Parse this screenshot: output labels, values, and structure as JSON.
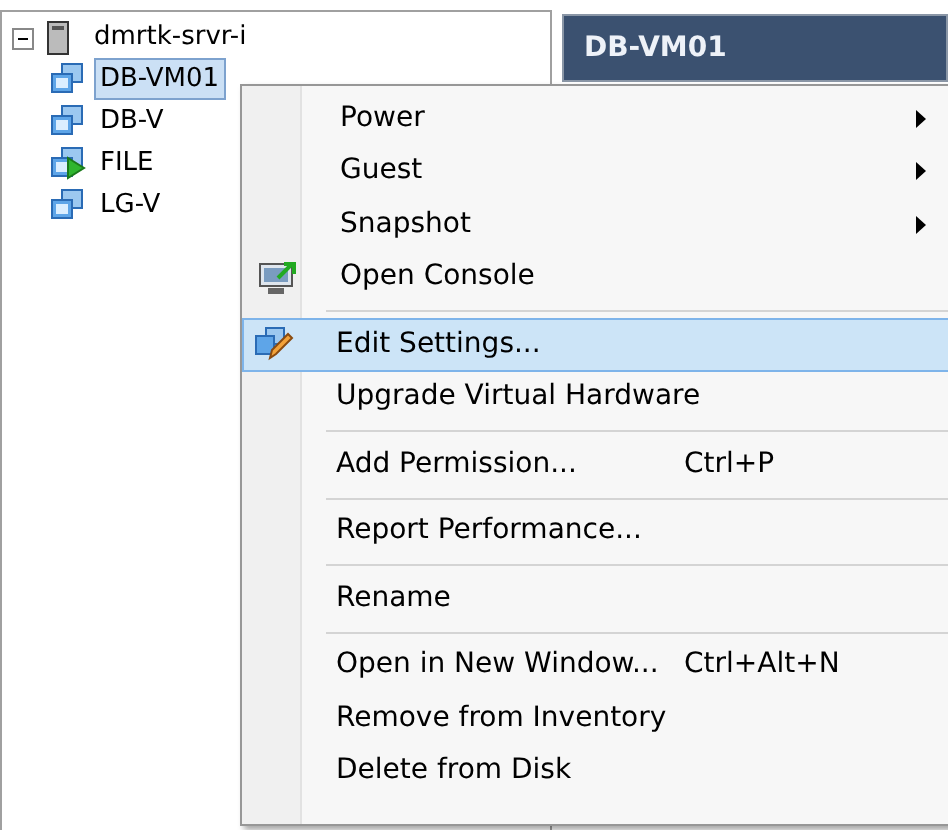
{
  "tree": {
    "root": {
      "label": "dmrtk-srvr-i",
      "expanded": true,
      "children": [
        {
          "label": "DB-VM01",
          "selected": true,
          "running": false
        },
        {
          "label": "DB-V",
          "selected": false,
          "running": false
        },
        {
          "label": "FILE",
          "selected": false,
          "running": true
        },
        {
          "label": "LG-V",
          "selected": false,
          "running": false
        }
      ]
    }
  },
  "header": {
    "title": "DB-VM01"
  },
  "context_menu": {
    "groups": [
      [
        {
          "label": "Power",
          "submenu": true,
          "selected": false
        },
        {
          "label": "Guest",
          "submenu": true,
          "selected": false
        },
        {
          "label": "Snapshot",
          "submenu": true,
          "selected": false
        },
        {
          "label": "Open Console",
          "submenu": false,
          "selected": false,
          "kind": "console"
        }
      ],
      [
        {
          "label": "Edit Settings...",
          "submenu": false,
          "selected": true,
          "kind": "edit"
        },
        {
          "label": "Upgrade Virtual Hardware",
          "submenu": false,
          "selected": false
        }
      ],
      [
        {
          "label": "Add Permission...",
          "shortcut": "Ctrl+P",
          "submenu": false,
          "selected": false
        }
      ],
      [
        {
          "label": "Report Performance...",
          "submenu": false,
          "selected": false
        }
      ],
      [
        {
          "label": "Rename",
          "submenu": false,
          "selected": false
        }
      ],
      [
        {
          "label": "Open in New Window...",
          "shortcut": "Ctrl+Alt+N",
          "submenu": false,
          "selected": false
        },
        {
          "label": "Remove from Inventory",
          "submenu": false,
          "selected": false
        },
        {
          "label": "Delete from Disk",
          "submenu": false,
          "selected": false
        }
      ]
    ]
  }
}
